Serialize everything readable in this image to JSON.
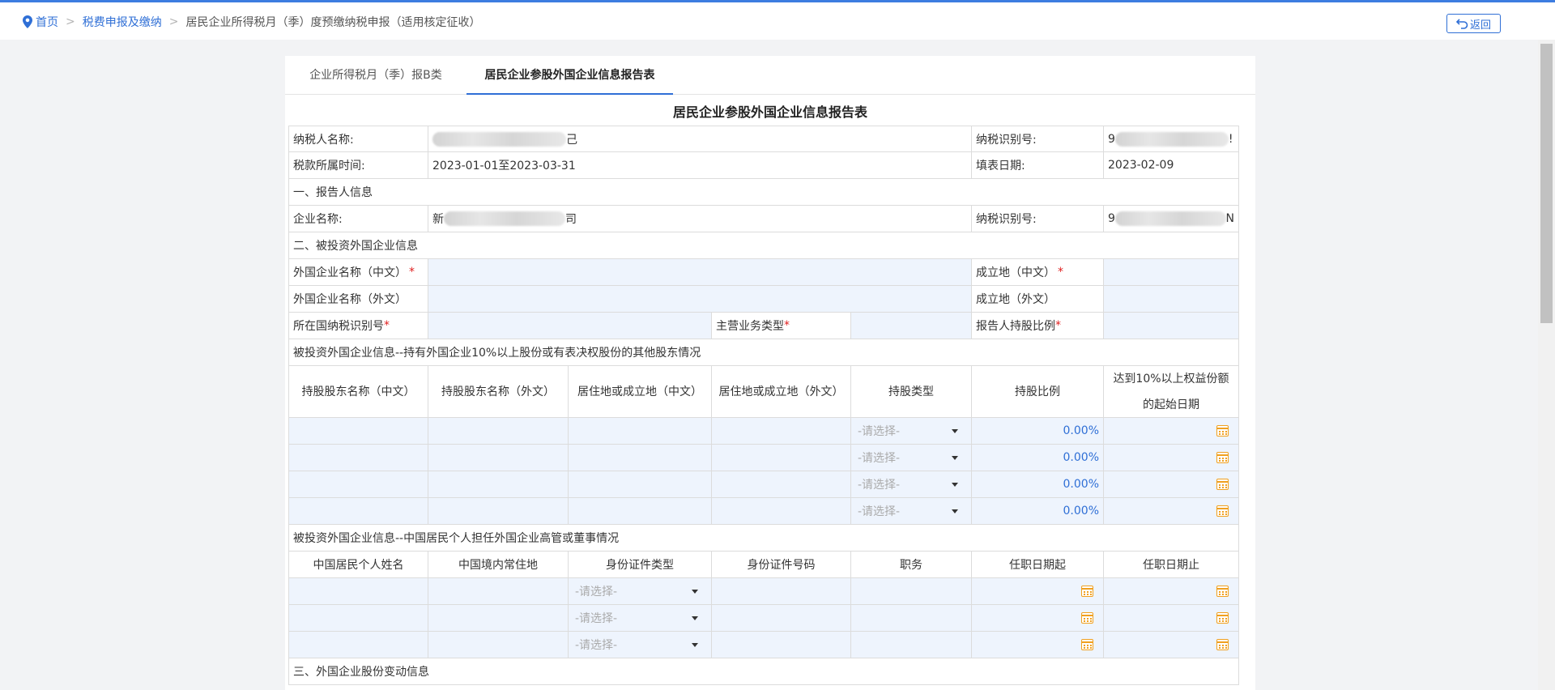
{
  "breadcrumb": {
    "home": "首页",
    "level2": "税费申报及缴纳",
    "current": "居民企业所得税月（季）度预缴纳税申报（适用核定征收）",
    "separator": ">"
  },
  "back_button": "返回",
  "tabs": [
    {
      "label": "企业所得税月（季）报B类",
      "active": false
    },
    {
      "label": "居民企业参股外国企业信息报告表",
      "active": true
    }
  ],
  "form": {
    "title": "居民企业参股外国企业信息报告表",
    "taxpayer_name_label": "纳税人名称:",
    "taxpayer_name_value_tail": "己",
    "taxpayer_id_label": "纳税识别号:",
    "taxpayer_id_value_head": "9",
    "taxpayer_id_value_tail": "!",
    "period_label": "税款所属时间:",
    "period_value": "2023-01-01至2023-03-31",
    "fill_date_label": "填表日期:",
    "fill_date_value": "2023-02-09",
    "section1": "一、报告人信息",
    "company_name_label": "企业名称:",
    "company_name_head": "新",
    "company_name_tail": "司",
    "company_id_label": "纳税识别号:",
    "company_id_head": "9",
    "company_id_tail": "N",
    "section2": "二、被投资外国企业信息",
    "foreign_name_cn_label": "外国企业名称（中文）",
    "est_place_cn_label": "成立地（中文）",
    "foreign_name_en_label": "外国企业名称（外文）",
    "est_place_en_label": "成立地（外文）",
    "country_tax_id_label": "所在国纳税识别号",
    "main_business_label": "主营业务类型",
    "holding_ratio_label": "报告人持股比例",
    "required_mark": "*",
    "shareholders_section": "被投资外国企业信息--持有外国企业10%以上股份或有表决权股份的其他股东情况",
    "shareholders_headers": [
      "持股股东名称（中文）",
      "持股股东名称（外文）",
      "居住地或成立地（中文）",
      "居住地或成立地（外文）",
      "持股类型",
      "持股比例",
      "达到10%以上权益份额的起始日期"
    ],
    "shareholders_rows": [
      {
        "type": "-请选择-",
        "ratio": "0.00%"
      },
      {
        "type": "-请选择-",
        "ratio": "0.00%"
      },
      {
        "type": "-请选择-",
        "ratio": "0.00%"
      },
      {
        "type": "-请选择-",
        "ratio": "0.00%"
      }
    ],
    "executives_section": "被投资外国企业信息--中国居民个人担任外国企业高管或董事情况",
    "executives_headers": [
      "中国居民个人姓名",
      "中国境内常住地",
      "身份证件类型",
      "身份证件号码",
      "职务",
      "任职日期起",
      "任职日期止"
    ],
    "executives_rows": [
      {
        "id_type": "-请选择-"
      },
      {
        "id_type": "-请选择-"
      },
      {
        "id_type": "-请选择-"
      }
    ],
    "section3": "三、外国企业股份变动信息"
  },
  "colors": {
    "accent": "#2f6fd6",
    "input_bg": "#eef4fd",
    "required": "#e02020",
    "calendar": "#f0a020"
  }
}
